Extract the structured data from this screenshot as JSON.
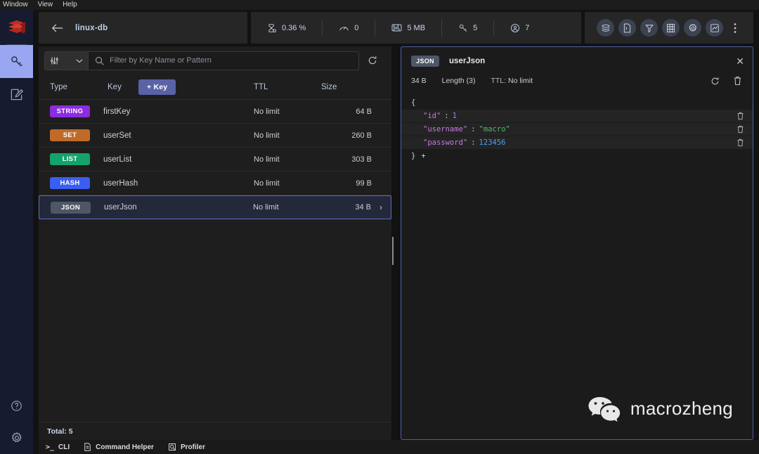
{
  "menubar": {
    "items": [
      {
        "label": "Window",
        "name": "menu-window"
      },
      {
        "label": "View",
        "name": "menu-view"
      },
      {
        "label": "Help",
        "name": "menu-help"
      }
    ]
  },
  "rail": {
    "logo": "redis-logo",
    "items": [
      {
        "name": "browser",
        "icon": "key-icon",
        "active": true
      },
      {
        "name": "workbench",
        "icon": "workbench-edit-icon",
        "active": false
      }
    ],
    "bottom": [
      {
        "name": "help",
        "icon": "question-circle-icon"
      },
      {
        "name": "settings",
        "icon": "gear-icon"
      }
    ]
  },
  "header": {
    "back_icon": "arrow-left-icon",
    "db_name": "linux-db",
    "stats": [
      {
        "icon": "cpu-icon",
        "value": "0.36 %",
        "name": "stat-cpu"
      },
      {
        "icon": "speedometer-icon",
        "value": "0",
        "name": "stat-commands-per-sec"
      },
      {
        "icon": "memory-icon",
        "value": "5 MB",
        "name": "stat-memory"
      },
      {
        "icon": "key-icon",
        "value": "5",
        "name": "stat-keys"
      },
      {
        "icon": "user-icon",
        "value": "7",
        "name": "stat-clients"
      }
    ],
    "modules": [
      {
        "name": "module-redisearch",
        "icon": "stack-icon"
      },
      {
        "name": "module-redisjson",
        "icon": "document-icon"
      },
      {
        "name": "module-redisgraph",
        "icon": "graph-icon"
      },
      {
        "name": "module-redisbloom",
        "icon": "grid-icon"
      },
      {
        "name": "module-redisgears",
        "icon": "gear-icon"
      },
      {
        "name": "module-redistimeseries",
        "icon": "chart-icon"
      }
    ],
    "overflow_icon": "dots-vertical-icon"
  },
  "keys_panel": {
    "filter": {
      "dropdown_icon": "sliders-icon",
      "chevron_icon": "chevron-down-icon",
      "search_icon": "search-icon",
      "placeholder": "Filter by Key Name or Pattern",
      "refresh_icon": "refresh-icon"
    },
    "columns": {
      "type": "Type",
      "key": "Key",
      "ttl": "TTL",
      "size": "Size"
    },
    "add_key_label": "+ Key",
    "rows": [
      {
        "type": "STRING",
        "color": "#8b2ce0",
        "key": "firstKey",
        "ttl": "No limit",
        "size": "64 B",
        "selected": false
      },
      {
        "type": "SET",
        "color": "#c06a2a",
        "key": "userSet",
        "ttl": "No limit",
        "size": "260 B",
        "selected": false
      },
      {
        "type": "LIST",
        "color": "#13a36b",
        "key": "userList",
        "ttl": "No limit",
        "size": "303 B",
        "selected": false
      },
      {
        "type": "HASH",
        "color": "#3a5ef0",
        "key": "userHash",
        "ttl": "No limit",
        "size": "99 B",
        "selected": false
      },
      {
        "type": "JSON",
        "color": "#4d5766",
        "key": "userJson",
        "ttl": "No limit",
        "size": "34 B",
        "selected": true
      }
    ],
    "total_label": "Total: 5"
  },
  "details_panel": {
    "type_badge": "JSON",
    "badge_color": "#4d5766",
    "key_name": "userJson",
    "close_icon": "close-icon",
    "size": "34 B",
    "length": "Length (3)",
    "ttl_label": "TTL:",
    "ttl_value": "No limit",
    "refresh_icon": "refresh-icon",
    "delete_icon": "trash-icon",
    "json": {
      "open_brace": "{",
      "close_brace": "}",
      "add_icon": "+",
      "entries": [
        {
          "key": "\"id\"",
          "colon": ":",
          "value": "1",
          "value_type": "number-purple",
          "delete_icon": "trash-icon"
        },
        {
          "key": "\"username\"",
          "colon": ":",
          "value": "\"macro\"",
          "value_type": "string",
          "delete_icon": "trash-icon"
        },
        {
          "key": "\"password\"",
          "colon": ":",
          "value": "123456",
          "value_type": "number-blue",
          "delete_icon": "trash-icon"
        }
      ]
    }
  },
  "watermark": {
    "icon": "wechat-icon",
    "text": "macrozheng"
  },
  "bottombar": {
    "items": [
      {
        "label": "CLI",
        "icon": "terminal-icon",
        "name": "cli"
      },
      {
        "label": "Command Helper",
        "icon": "doc-icon",
        "name": "command-helper"
      },
      {
        "label": "Profiler",
        "icon": "search-doc-icon",
        "name": "profiler"
      }
    ]
  }
}
